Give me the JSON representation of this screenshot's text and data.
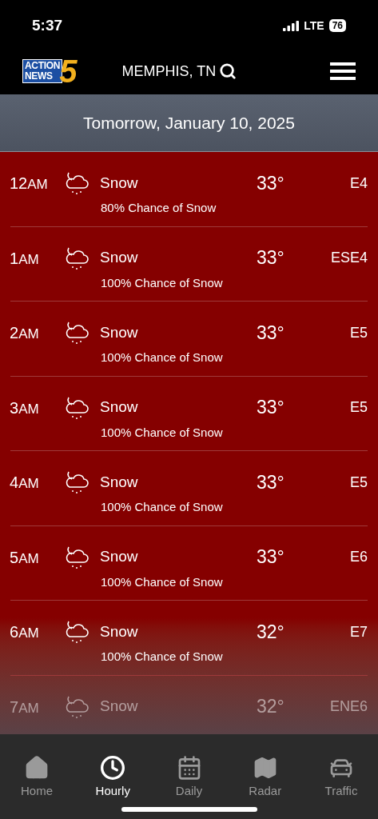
{
  "status_bar": {
    "time": "5:37",
    "network": "LTE",
    "battery": "76"
  },
  "header": {
    "logo": {
      "line_1": "ACTION",
      "line_2": "NEWS",
      "number": "5"
    },
    "location": "MEMPHIS, TN"
  },
  "date_banner": "Tomorrow, January 10, 2025",
  "hours": [
    {
      "hour": "12",
      "suffix": "AM",
      "condition": "Snow",
      "chance": "80% Chance of Snow",
      "temp": "33°",
      "wind": "E4",
      "dimmed": false
    },
    {
      "hour": "1",
      "suffix": "AM",
      "condition": "Snow",
      "chance": "100% Chance of Snow",
      "temp": "33°",
      "wind": "ESE4",
      "dimmed": false
    },
    {
      "hour": "2",
      "suffix": "AM",
      "condition": "Snow",
      "chance": "100% Chance of Snow",
      "temp": "33°",
      "wind": "E5",
      "dimmed": false
    },
    {
      "hour": "3",
      "suffix": "AM",
      "condition": "Snow",
      "chance": "100% Chance of Snow",
      "temp": "33°",
      "wind": "E5",
      "dimmed": false
    },
    {
      "hour": "4",
      "suffix": "AM",
      "condition": "Snow",
      "chance": "100% Chance of Snow",
      "temp": "33°",
      "wind": "E5",
      "dimmed": false
    },
    {
      "hour": "5",
      "suffix": "AM",
      "condition": "Snow",
      "chance": "100% Chance of Snow",
      "temp": "33°",
      "wind": "E6",
      "dimmed": false
    },
    {
      "hour": "6",
      "suffix": "AM",
      "condition": "Snow",
      "chance": "100% Chance of Snow",
      "temp": "32°",
      "wind": "E7",
      "dimmed": false
    },
    {
      "hour": "7",
      "suffix": "AM",
      "condition": "Snow",
      "temp": "32°",
      "wind": "ENE6",
      "dimmed": true
    }
  ],
  "tab_bar": [
    {
      "kind": "home",
      "label": "Home",
      "selected": false
    },
    {
      "kind": "hourly",
      "label": "Hourly",
      "selected": true
    },
    {
      "kind": "daily",
      "label": "Daily",
      "selected": false
    },
    {
      "kind": "radar",
      "label": "Radar",
      "selected": false
    },
    {
      "kind": "traffic",
      "label": "Traffic",
      "selected": false
    }
  ]
}
